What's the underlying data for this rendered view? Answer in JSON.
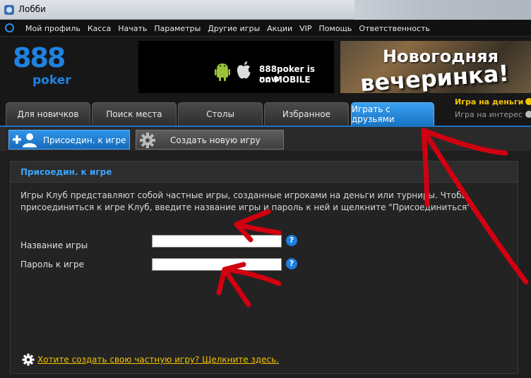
{
  "window": {
    "title": "Лобби"
  },
  "menu": {
    "items": [
      "Мой профиль",
      "Касса",
      "Начать",
      "Параметры",
      "Другие игры",
      "Акции",
      "VIP",
      "Помощь",
      "Ответственность"
    ]
  },
  "brand": {
    "number": "888",
    "word": "poker"
  },
  "banners": {
    "mobile_line1": "888poker is now",
    "mobile_line2": "on MOBILE",
    "party_line1": "Новогодняя",
    "party_line2": "вечеринка!"
  },
  "tabs": [
    "Для новичков",
    "Поиск места",
    "Столы",
    "Избранное",
    "Играть с друзьями"
  ],
  "active_tab": "Играть с друзьями",
  "mode": {
    "real": "Игра на деньги",
    "play": "Игра на интерес"
  },
  "subbar": {
    "join": "Присоедин. к игре",
    "create": "Создать новую игру"
  },
  "panel": {
    "title": "Присоедин. к игре",
    "description": "Игры Клуб представляют собой частные игры, созданные игроками на деньги или турниры. Чтобы присоединиться к игре Клуб, введите название игры и пароль к ней и щелкните \"Присоединиться\".",
    "game_name_label": "Название игры",
    "game_name_value": "",
    "password_label": "Пароль к игре",
    "password_value": "",
    "help_glyph": "?",
    "create_link": "Хотите создать свою частную игру? Щелкните здесь."
  },
  "colors": {
    "accent": "#1f82e0",
    "gold": "#f3c300",
    "annotation": "#d10010"
  }
}
